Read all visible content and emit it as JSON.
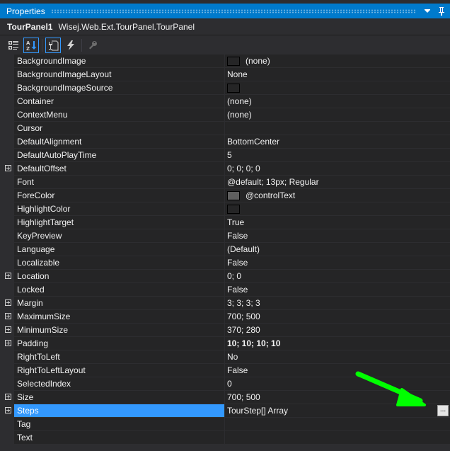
{
  "window": {
    "title": "Properties",
    "dropdown_icon": "dropdown-arrow-icon",
    "pin_icon": "pin-icon"
  },
  "object": {
    "name": "TourPanel1",
    "type": "Wisej.Web.Ext.TourPanel.TourPanel"
  },
  "toolbar": {
    "buttons": [
      {
        "name": "categorized-icon",
        "active": false
      },
      {
        "name": "alphabetical-icon",
        "active": true
      },
      {
        "name": "properties-icon",
        "active": true
      },
      {
        "name": "events-icon",
        "active": false
      },
      {
        "name": "property-pages-icon",
        "active": false
      }
    ]
  },
  "properties": [
    {
      "name": "BackgroundImage",
      "value": "(none)",
      "swatch": "empty",
      "expandable": false
    },
    {
      "name": "BackgroundImageLayout",
      "value": "None",
      "expandable": false
    },
    {
      "name": "BackgroundImageSource",
      "value": "",
      "swatch": "empty",
      "expandable": false
    },
    {
      "name": "Container",
      "value": "(none)",
      "expandable": false
    },
    {
      "name": "ContextMenu",
      "value": "(none)",
      "expandable": false
    },
    {
      "name": "Cursor",
      "value": "",
      "expandable": false
    },
    {
      "name": "DefaultAlignment",
      "value": "BottomCenter",
      "expandable": false
    },
    {
      "name": "DefaultAutoPlayTime",
      "value": "5",
      "expandable": false
    },
    {
      "name": "DefaultOffset",
      "value": "0; 0; 0; 0",
      "expandable": true
    },
    {
      "name": "Font",
      "value": "@default; 13px; Regular",
      "expandable": false
    },
    {
      "name": "ForeColor",
      "value": "@controlText",
      "swatch": "gray",
      "expandable": false
    },
    {
      "name": "HighlightColor",
      "value": "",
      "swatch": "empty",
      "expandable": false
    },
    {
      "name": "HighlightTarget",
      "value": "True",
      "expandable": false
    },
    {
      "name": "KeyPreview",
      "value": "False",
      "expandable": false
    },
    {
      "name": "Language",
      "value": "(Default)",
      "expandable": false
    },
    {
      "name": "Localizable",
      "value": "False",
      "expandable": false
    },
    {
      "name": "Location",
      "value": "0; 0",
      "expandable": true
    },
    {
      "name": "Locked",
      "value": "False",
      "expandable": false
    },
    {
      "name": "Margin",
      "value": "3; 3; 3; 3",
      "expandable": true
    },
    {
      "name": "MaximumSize",
      "value": "700; 500",
      "expandable": true
    },
    {
      "name": "MinimumSize",
      "value": "370; 280",
      "expandable": true
    },
    {
      "name": "Padding",
      "value": "10; 10; 10; 10",
      "expandable": true,
      "bold": true
    },
    {
      "name": "RightToLeft",
      "value": "No",
      "expandable": false
    },
    {
      "name": "RightToLeftLayout",
      "value": "False",
      "expandable": false
    },
    {
      "name": "SelectedIndex",
      "value": "0",
      "expandable": false
    },
    {
      "name": "Size",
      "value": "700; 500",
      "expandable": true
    },
    {
      "name": "Steps",
      "value": "TourStep[] Array",
      "expandable": true,
      "selected": true,
      "ellipsis": "..."
    },
    {
      "name": "Tag",
      "value": "",
      "expandable": false
    },
    {
      "name": "Text",
      "value": "",
      "expandable": false
    }
  ],
  "annotation": {
    "arrow_color": "#00ff00",
    "points_to": "steps-ellipsis-button"
  },
  "colors": {
    "accent": "#007acc",
    "selection": "#3399ff",
    "background": "#252526",
    "chrome": "#2d2d30",
    "text": "#f1f1f1"
  }
}
